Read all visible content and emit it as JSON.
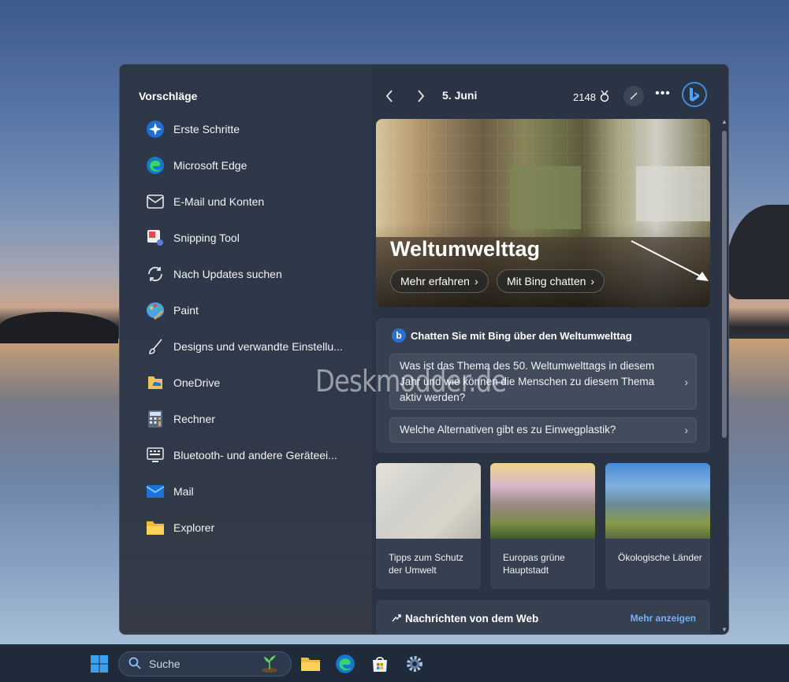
{
  "sidebar": {
    "title": "Vorschläge",
    "items": [
      {
        "label": "Erste Schritte",
        "icon": "get-started-icon"
      },
      {
        "label": "Microsoft Edge",
        "icon": "edge-icon"
      },
      {
        "label": "E-Mail und Konten",
        "icon": "mail-envelope-icon"
      },
      {
        "label": "Snipping Tool",
        "icon": "snipping-tool-icon"
      },
      {
        "label": "Nach Updates suchen",
        "icon": "update-refresh-icon"
      },
      {
        "label": "Paint",
        "icon": "paint-palette-icon"
      },
      {
        "label": "Designs und verwandte Einstellu...",
        "icon": "brush-icon"
      },
      {
        "label": "OneDrive",
        "icon": "onedrive-folder-icon"
      },
      {
        "label": "Rechner",
        "icon": "calculator-icon"
      },
      {
        "label": "Bluetooth- und andere Geräteei...",
        "icon": "devices-icon"
      },
      {
        "label": "Mail",
        "icon": "mail-app-icon"
      },
      {
        "label": "Explorer",
        "icon": "file-explorer-icon"
      }
    ]
  },
  "topbar": {
    "date": "5. Juni",
    "points": "2148"
  },
  "hero": {
    "title": "Weltumwelttag",
    "button1": "Mehr erfahren",
    "button2": "Mit Bing chatten"
  },
  "chat": {
    "heading": "Chatten Sie mit Bing über den Weltumwelttag",
    "question1": "Was ist das Thema des 50. Weltumwelttags in diesem Jahr und wie können die Menschen zu diesem Thema aktiv werden?",
    "question2": "Welche Alternativen gibt es zu Einwegplastik?"
  },
  "tiles": [
    {
      "caption": "Tipps zum Schutz der Umwelt"
    },
    {
      "caption": "Europas grüne Hauptstadt"
    },
    {
      "caption": "Ökologische Länder"
    }
  ],
  "news": {
    "title": "Nachrichten von dem Web",
    "more": "Mehr anzeigen"
  },
  "watermark": "Deskmodder.de",
  "taskbar": {
    "search_placeholder": "Suche"
  },
  "colors": {
    "panel_bg": "#2b3444",
    "card_bg": "#364050",
    "accent_link": "#6fb3ff",
    "bing_blue": "#3f8bd9"
  }
}
